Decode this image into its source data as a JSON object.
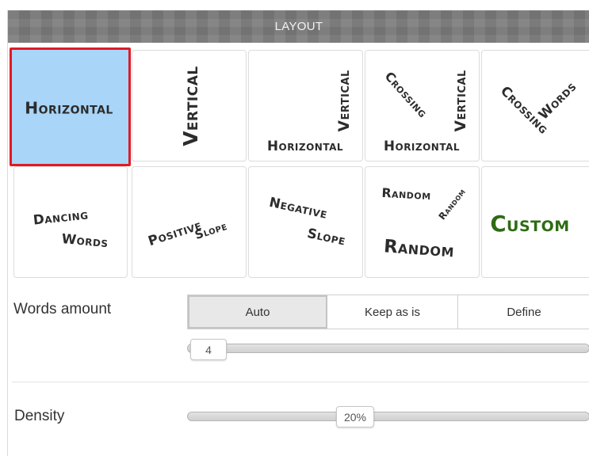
{
  "header": {
    "title": "LAYOUT"
  },
  "layout_tiles": [
    {
      "id": "horizontal",
      "words": [
        "Horizontal"
      ],
      "selected": true
    },
    {
      "id": "vertical",
      "words": [
        "Vertical"
      ],
      "selected": false
    },
    {
      "id": "vertical-horizontal",
      "words": [
        "Vertical",
        "Horizontal"
      ],
      "selected": false
    },
    {
      "id": "crossing-vertical-horizontal",
      "words": [
        "Crossing",
        "Vertical",
        "Horizontal"
      ],
      "selected": false
    },
    {
      "id": "crossing-words",
      "words": [
        "Crossing",
        "Words"
      ],
      "selected": false
    },
    {
      "id": "dancing-words",
      "words": [
        "Dancing",
        "Words"
      ],
      "selected": false
    },
    {
      "id": "positive-slope",
      "words": [
        "Positive",
        "Slope"
      ],
      "selected": false
    },
    {
      "id": "negative-slope",
      "words": [
        "Negative",
        "Slope"
      ],
      "selected": false
    },
    {
      "id": "random",
      "words": [
        "Random",
        "Random",
        "Random"
      ],
      "selected": false
    },
    {
      "id": "custom",
      "words": [
        "Custom"
      ],
      "selected": false
    }
  ],
  "words_amount": {
    "label": "Words amount",
    "options": [
      "Auto",
      "Keep as is",
      "Define"
    ],
    "selected": "Auto",
    "slider_value": "4"
  },
  "density": {
    "label": "Density",
    "value": "20%"
  },
  "colors": {
    "selected_bg": "#a8d5f8",
    "selected_border": "#e01b24",
    "header_bg": "#7b7b7b",
    "custom_text": "#2e6b14"
  }
}
